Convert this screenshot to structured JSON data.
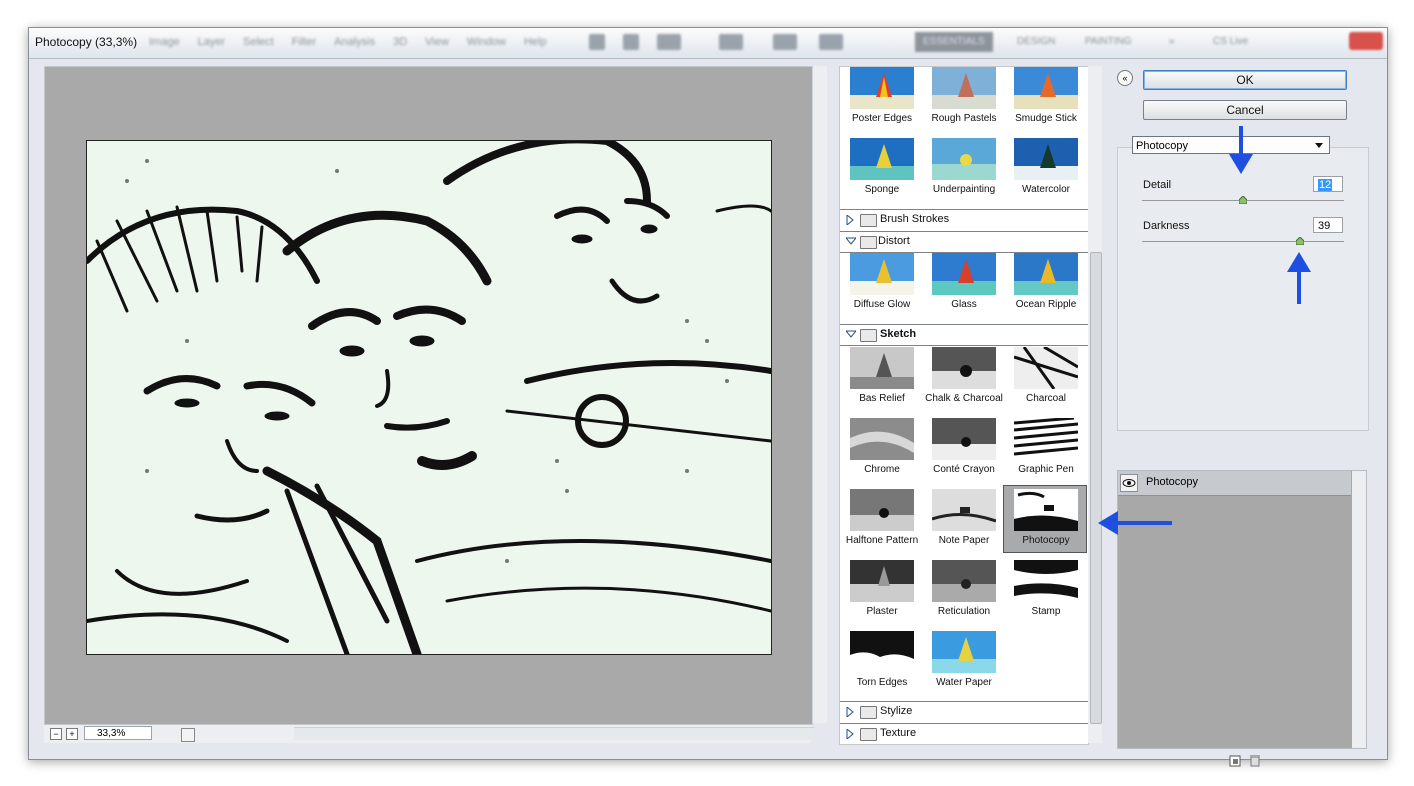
{
  "window": {
    "title": "Photocopy (33,3%)"
  },
  "menubar": {
    "items": [
      "Image",
      "Layer",
      "Select",
      "Filter",
      "Analysis",
      "3D",
      "View",
      "Window",
      "Help"
    ]
  },
  "workspace": {
    "items": [
      "ESSENTIALS",
      "DESIGN",
      "PAINTING",
      "»",
      "CS Live"
    ]
  },
  "zoom": {
    "value": "33,3%",
    "minus": "−",
    "plus": "+"
  },
  "gallery": {
    "artistic_tail": [
      {
        "label": "Poster Edges"
      },
      {
        "label": "Rough Pastels"
      },
      {
        "label": "Smudge Stick"
      },
      {
        "label": "Sponge"
      },
      {
        "label": "Underpainting"
      },
      {
        "label": "Watercolor"
      }
    ],
    "categories": {
      "brush_strokes": "Brush Strokes",
      "distort": "Distort",
      "sketch": "Sketch",
      "stylize": "Stylize",
      "texture": "Texture"
    },
    "distort": [
      {
        "label": "Diffuse Glow"
      },
      {
        "label": "Glass"
      },
      {
        "label": "Ocean Ripple"
      }
    ],
    "sketch": [
      {
        "label": "Bas Relief"
      },
      {
        "label": "Chalk & Charcoal"
      },
      {
        "label": "Charcoal"
      },
      {
        "label": "Chrome"
      },
      {
        "label": "Conté Crayon"
      },
      {
        "label": "Graphic Pen"
      },
      {
        "label": "Halftone Pattern"
      },
      {
        "label": "Note Paper"
      },
      {
        "label": "Photocopy"
      },
      {
        "label": "Plaster"
      },
      {
        "label": "Reticulation"
      },
      {
        "label": "Stamp"
      },
      {
        "label": "Torn Edges"
      },
      {
        "label": "Water Paper"
      }
    ],
    "selected": "Photocopy"
  },
  "buttons": {
    "ok": "OK",
    "cancel": "Cancel",
    "collapse": "«"
  },
  "filter_select": {
    "value": "Photocopy"
  },
  "params": {
    "detail": {
      "label": "Detail",
      "value": "12",
      "fraction": 0.5
    },
    "darkness": {
      "label": "Darkness",
      "value": "39",
      "fraction": 0.78
    }
  },
  "effect_layers": {
    "items": [
      {
        "label": "Photocopy"
      }
    ]
  },
  "colors": {
    "accent_arrow": "#1f4fe0",
    "ok_border": "#3d7fc6"
  }
}
